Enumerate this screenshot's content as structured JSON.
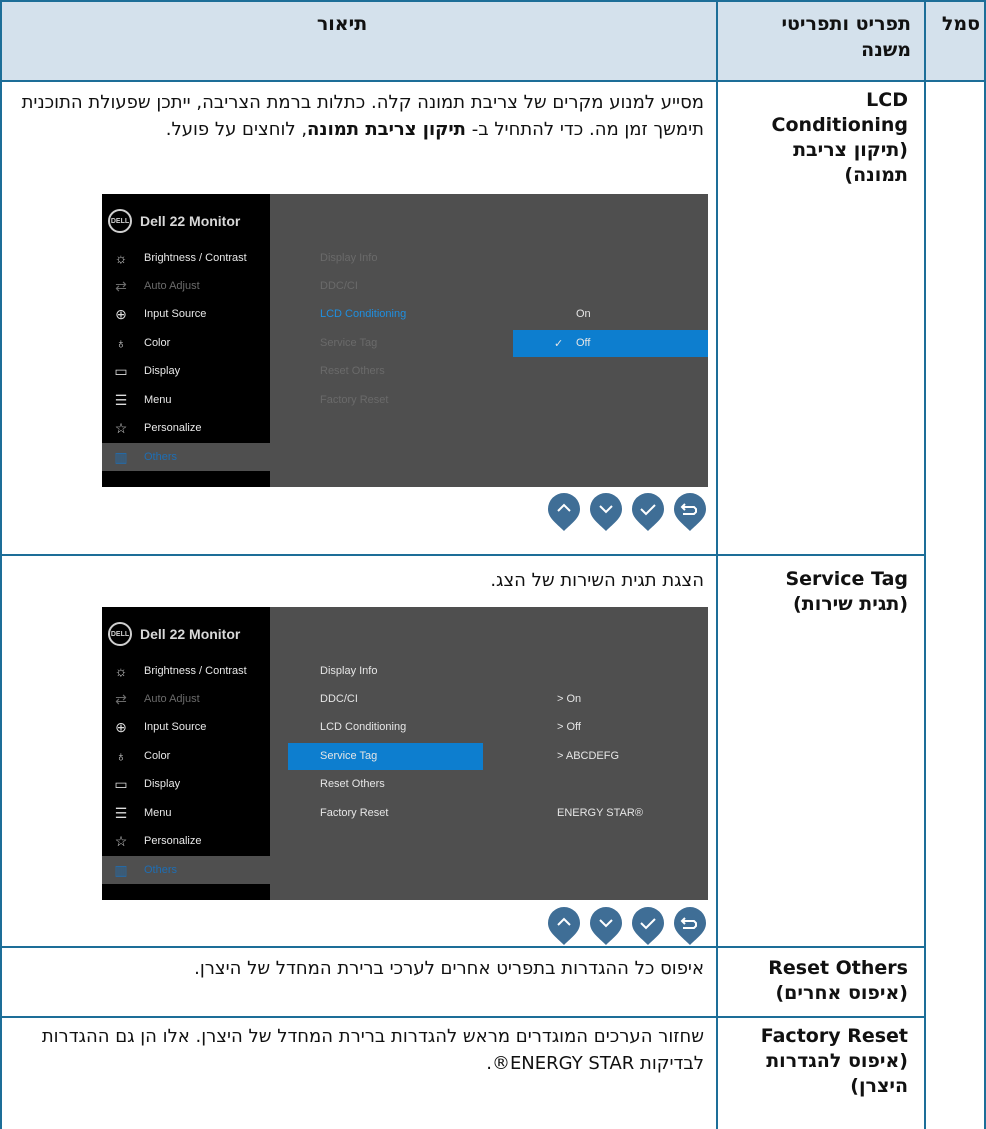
{
  "header": {
    "col_symbol": "סמל",
    "col_menu": "תפריט ותפריטי משנה",
    "col_desc": "תיאור"
  },
  "rows": [
    {
      "name_en": "LCD Conditioning",
      "name_he": "(תיקון צריבת תמונה)",
      "desc_part1": "מסייע למנוע מקרים של צריבת תמונה קלה. כתלות ברמת הצריבה, ייתכן שפעולת התוכנית תימשך זמן מה. כדי להתחיל ב- ",
      "desc_bold": "תיקון צריבת תמונה",
      "desc_part2": ", לוחצים על פועל."
    },
    {
      "name_en": "Service Tag",
      "name_he": "(תגית שירות)",
      "desc": "הצגת תגית השירות של הצג."
    },
    {
      "name_en": "Reset Others",
      "name_he": "(איפוס אחרים)",
      "desc": "איפוס כל ההגדרות בתפריט אחרים לערכי ברירת המחדל של היצרן."
    },
    {
      "name_en": "Factory Reset",
      "name_he": "(איפוס להגדרות היצרן)",
      "desc_part1": "שחזור הערכים המוגדרים מראש להגדרות ברירת המחדל של היצרן. אלו הן גם ההגדרות לבדיקות ",
      "desc_energy": "®ENERGY STAR",
      "desc_part2": "."
    }
  ],
  "osd": {
    "logo": "DELL",
    "model": "Dell 22 Monitor",
    "side_items": [
      "Brightness / Contrast",
      "Auto Adjust",
      "Input Source",
      "Color",
      "Display",
      "Menu",
      "Personalize",
      "Others"
    ],
    "side_icons": [
      "brightness-icon",
      "auto-adjust-icon",
      "input-source-icon",
      "color-icon",
      "display-icon",
      "menu-icon",
      "personalize-icon",
      "others-icon"
    ],
    "sub_items": [
      "Display Info",
      "DDC/CI",
      "LCD Conditioning",
      "Service Tag",
      "Reset Others",
      "Factory Reset"
    ],
    "osd1_values": [
      "On",
      "Off"
    ],
    "osd1_check": "✓",
    "osd2_values": [
      "> On",
      "> Off",
      "> ABCDEFG"
    ],
    "energy_star": "ENERGY STAR®"
  },
  "colors": {
    "header_bg": "#d4e1ec",
    "border": "#1d6e98",
    "osd_highlight": "#0d7ecf",
    "osd_selected_text": "#1e6eb4",
    "nav_button": "#3f6e96"
  },
  "nav_buttons": [
    "up-arrow-icon",
    "down-arrow-icon",
    "checkmark-icon",
    "back-icon"
  ]
}
